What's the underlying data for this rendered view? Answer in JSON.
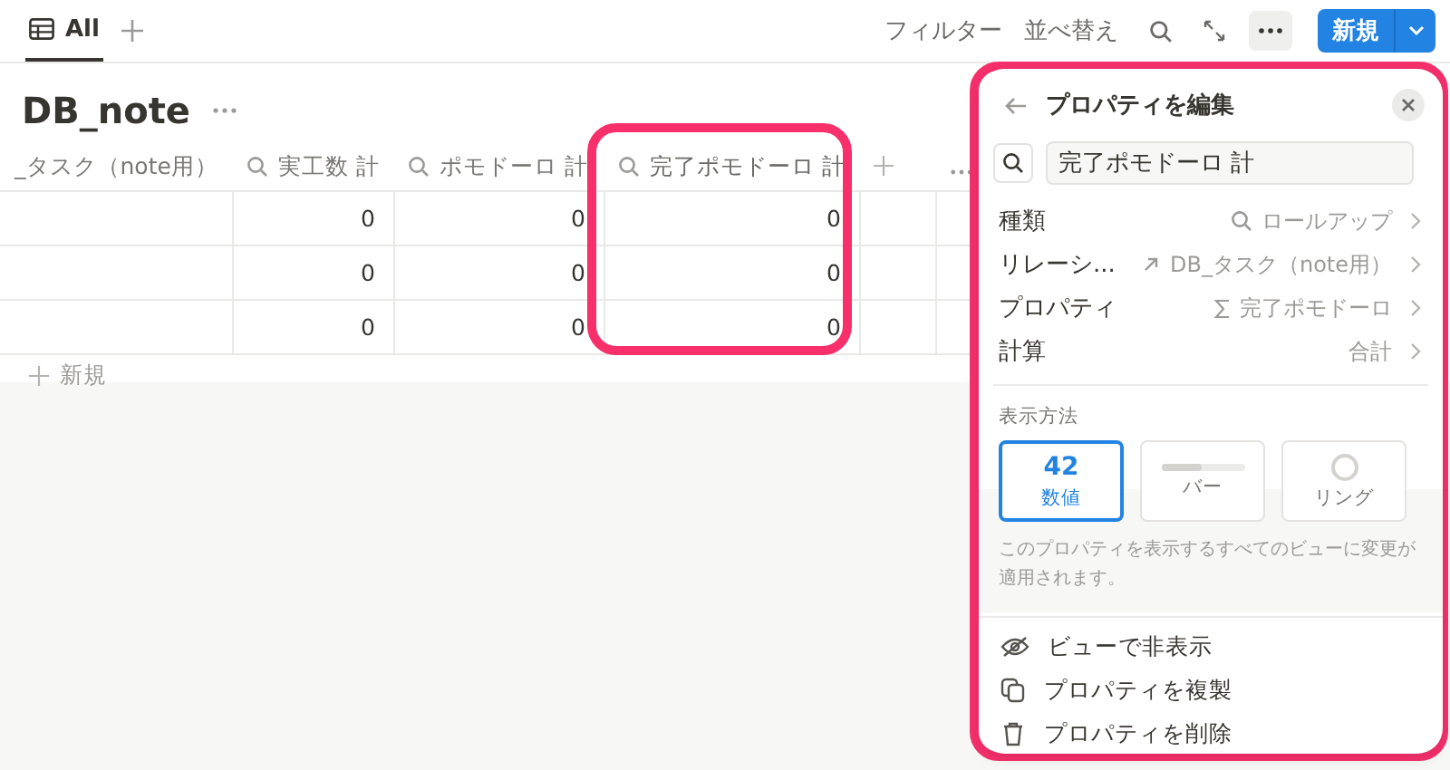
{
  "view_tabs": [
    {
      "label": "All",
      "selected": true
    }
  ],
  "toolbar": {
    "actions": [
      "フィルター",
      "並べ替え"
    ],
    "new_button": "新規"
  },
  "database": {
    "title": "DB_note"
  },
  "table": {
    "columns": [
      {
        "label": "_タスク（note用）",
        "kind": "relation",
        "highlighted": false
      },
      {
        "label": "実工数 計",
        "kind": "rollup",
        "highlighted": false
      },
      {
        "label": "ポモドーロ 計",
        "kind": "rollup",
        "highlighted": false
      },
      {
        "label": "完了ポモドーロ 計",
        "kind": "rollup",
        "highlighted": true
      }
    ],
    "rows": [
      [
        "",
        "0",
        "0",
        "0"
      ],
      [
        "",
        "0",
        "0",
        "0"
      ],
      [
        "",
        "0",
        "0",
        "0"
      ]
    ],
    "new_row": "新規"
  },
  "panel": {
    "title": "プロパティを編集",
    "name_value": "完了ポモドーロ 計",
    "fields": [
      {
        "label": "種類",
        "value": "ロールアップ"
      },
      {
        "label": "リレーシ...",
        "value": "DB_タスク（note用）"
      },
      {
        "label": "プロパティ",
        "value": "完了ポモドーロ"
      },
      {
        "label": "計算",
        "value": "合計"
      }
    ],
    "display_heading": "表示方法",
    "display_options": [
      {
        "kind": "number",
        "preview": "42",
        "label": "数値",
        "selected": true
      },
      {
        "kind": "bar",
        "label": "バー",
        "selected": false
      },
      {
        "kind": "ring",
        "label": "リング",
        "selected": false
      }
    ],
    "note": "このプロパティを表示するすべてのビューに変更が適用されます。",
    "actions": [
      {
        "kind": "hide",
        "label": "ビューで非表示"
      },
      {
        "kind": "duplicate",
        "label": "プロパティを複製"
      },
      {
        "kind": "delete",
        "label": "プロパティを削除"
      }
    ]
  }
}
